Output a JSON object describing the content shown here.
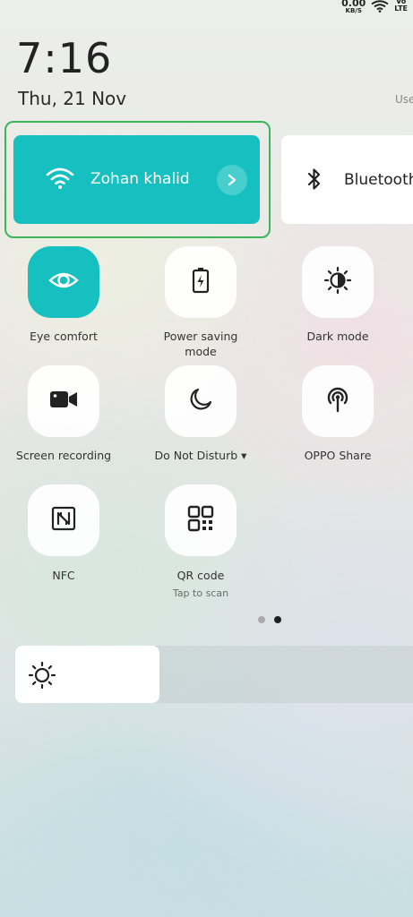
{
  "status_bar": {
    "net_speed_value": "0.00",
    "net_speed_unit": "KB/S",
    "volte_top": "Vo",
    "volte_bottom": "LTE"
  },
  "header": {
    "time": "7:16",
    "date": "Thu, 21 Nov",
    "right_link": "Use"
  },
  "wifi": {
    "network_name": "Zohan khalid",
    "active": true,
    "accent_color": "#17c0c0",
    "icon": "wifi-icon"
  },
  "bluetooth": {
    "label": "Bluetooth",
    "icon": "bluetooth-icon"
  },
  "toggles": [
    {
      "label": "Eye comfort",
      "icon": "eye-icon",
      "active": true
    },
    {
      "label": "Power saving mode",
      "icon": "battery-bolt-icon",
      "active": false
    },
    {
      "label": "Dark mode",
      "icon": "dark-mode-icon",
      "active": false
    },
    {
      "label": "Screen recording",
      "icon": "video-camera-icon",
      "active": false
    },
    {
      "label": "Do Not Disturb",
      "icon": "moon-icon",
      "active": false
    },
    {
      "label": "OPPO Share",
      "icon": "share-signal-icon",
      "active": false
    },
    {
      "label": "NFC",
      "icon": "nfc-icon",
      "active": false
    },
    {
      "label": "QR code",
      "sublabel": "Tap to scan",
      "icon": "qr-code-icon",
      "active": false
    }
  ],
  "toggle_labels": {
    "power_saving_line1": "Power saving",
    "power_saving_line2": "mode",
    "dnd_arrow": "▾"
  },
  "pager": {
    "pages": 2,
    "current": 2
  },
  "brightness": {
    "level": 0.35,
    "icon": "sun-icon"
  },
  "highlight_color": "#3cb55a"
}
